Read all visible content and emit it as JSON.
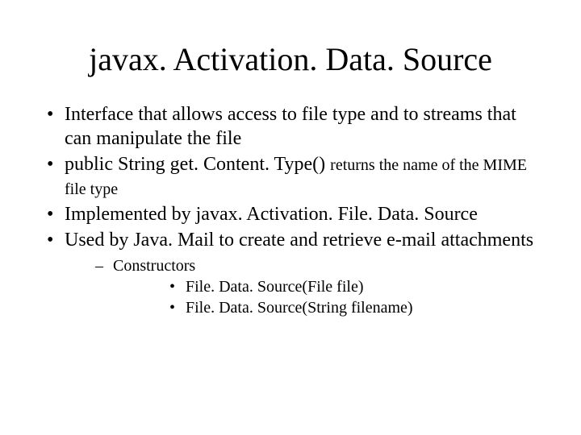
{
  "title": "javax. Activation. Data. Source",
  "bullets": [
    {
      "text": "Interface that allows access to file type and to streams that can manipulate the file"
    },
    {
      "text": "public String get. Content. Type() ",
      "tail": "returns the name of the MIME file type"
    },
    {
      "text": "Implemented by javax. Activation. File. Data. Source"
    },
    {
      "text": "Used by Java. Mail to create and retrieve e-mail attachments"
    }
  ],
  "sub": {
    "heading": "Constructors",
    "items": [
      "File. Data. Source(File file)",
      "File. Data. Source(String filename)"
    ]
  }
}
